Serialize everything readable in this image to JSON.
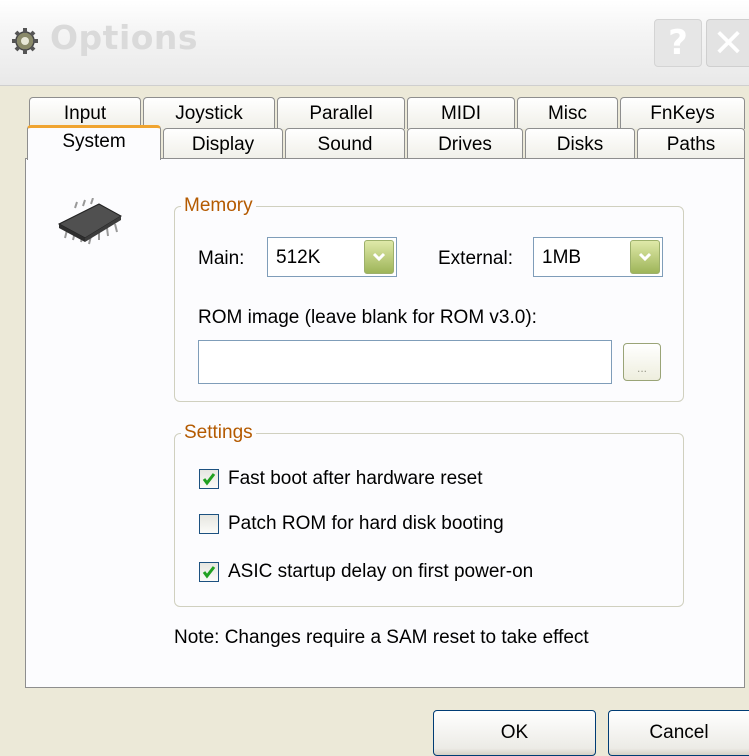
{
  "window": {
    "title": "Options",
    "help_label": "?",
    "close_label": "✕"
  },
  "tabs_back": [
    "Input",
    "Joystick",
    "Parallel",
    "MIDI",
    "Misc",
    "FnKeys"
  ],
  "tabs_front": [
    "System",
    "Display",
    "Sound",
    "Drives",
    "Disks",
    "Paths"
  ],
  "active_tab": "System",
  "memory": {
    "legend": "Memory",
    "main_label": "Main:",
    "main_value": "512K",
    "external_label": "External:",
    "external_value": "1MB",
    "rom_label": "ROM image (leave blank for ROM v3.0):",
    "rom_value": "",
    "browse_label": "..."
  },
  "settings": {
    "legend": "Settings",
    "options": [
      {
        "label": "Fast boot after hardware reset",
        "checked": true
      },
      {
        "label": "Patch ROM for hard disk booting",
        "checked": false
      },
      {
        "label": "ASIC startup delay on first power-on",
        "checked": true
      }
    ]
  },
  "note": "Note: Changes require a SAM reset to take effect",
  "buttons": {
    "ok": "OK",
    "cancel": "Cancel"
  },
  "colors": {
    "accent_tab": "#f0a430",
    "legend_text": "#b45a00",
    "check": "#21a121"
  },
  "icons": {
    "app": "gear-icon",
    "page": "memory-chip-icon",
    "combo": "chevron-down-icon",
    "check": "check-icon"
  }
}
